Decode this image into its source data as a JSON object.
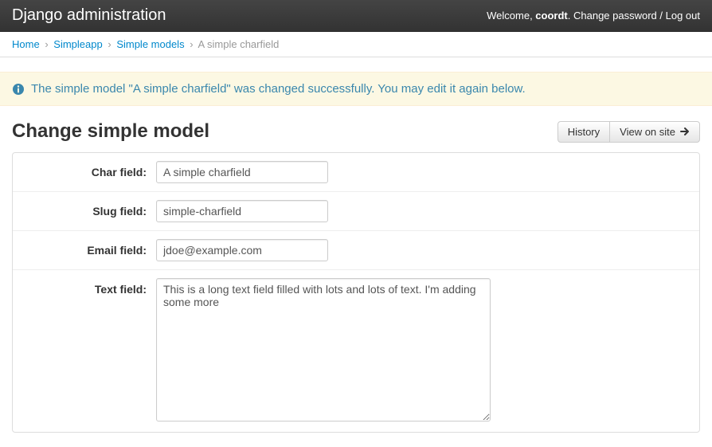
{
  "header": {
    "title": "Django administration",
    "welcome_prefix": "Welcome, ",
    "username": "coordt",
    "change_password": "Change password",
    "logout": "Log out"
  },
  "breadcrumb": {
    "items": [
      {
        "label": "Home",
        "link": true
      },
      {
        "label": "Simpleapp",
        "link": true
      },
      {
        "label": "Simple models",
        "link": true
      },
      {
        "label": "A simple charfield",
        "link": false
      }
    ]
  },
  "message": {
    "text": "The simple model \"A simple charfield\" was changed successfully. You may edit it again below."
  },
  "page": {
    "heading": "Change simple model",
    "history_btn": "History",
    "view_on_site_btn": "View on site"
  },
  "form": {
    "char_label": "Char field:",
    "char_value": "A simple charfield",
    "slug_label": "Slug field:",
    "slug_value": "simple-charfield",
    "email_label": "Email field:",
    "email_value": "jdoe@example.com",
    "text_label": "Text field:",
    "text_value": "This is a long text field filled with lots and lots of text. I'm adding some more"
  }
}
